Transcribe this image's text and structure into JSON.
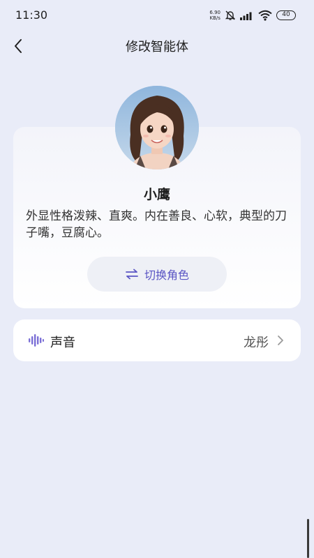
{
  "status_bar": {
    "time": "11:30",
    "net_speed_value": "6.90",
    "net_speed_unit": "KB/s",
    "battery": "40"
  },
  "header": {
    "title": "修改智能体"
  },
  "profile": {
    "name": "小鹰",
    "description": "外显性格泼辣、直爽。内在善良、心软，典型的刀子嘴，豆腐心。",
    "switch_role_label": "切换角色"
  },
  "voice": {
    "label": "声音",
    "value": "龙彤"
  },
  "colors": {
    "background": "#e9ecf8",
    "accent": "#5a55c4",
    "voice_icon": "#7b6fd6"
  },
  "icons": {
    "back": "chevron-left-icon",
    "switch": "swap-arrows-icon",
    "voice": "sound-wave-icon",
    "more": "chevron-right-icon"
  }
}
